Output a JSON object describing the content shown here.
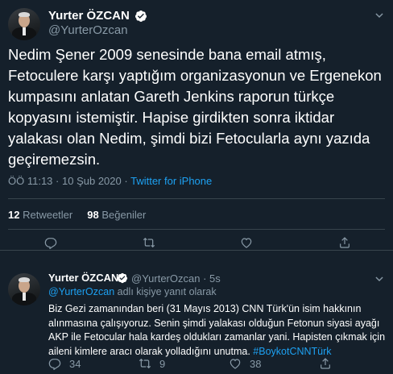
{
  "main_tweet": {
    "author_name": "Yurter ÖZCAN",
    "author_handle": "@YurterOzcan",
    "text_lines": [
      "Nedim Şener 2009 senesinde bana email atmış,",
      "Fetoculere karşı yaptığım organizasyonun ve Ergenekon",
      "kumpasını anlatan Gareth Jenkins raporun türkçe",
      "kopyasını istemiştir. Hapise girdikten sonra iktidar",
      "yalakası olan Nedim, şimdi bizi Fetocularla aynı yazıda",
      "geçiremezsin."
    ],
    "time": "ÖÖ 11:13",
    "separator": "·",
    "date": "10 Şub 2020",
    "source": "Twitter for iPhone",
    "retweet_count": "12",
    "retweet_label": "Retweetler",
    "like_count": "98",
    "like_label": "Beğeniler"
  },
  "reply": {
    "author_name": "Yurter ÖZCAN",
    "author_handle": "@YurterOzcan",
    "separator": "·",
    "age": "5s",
    "replying_mention": "@YurterOzcan",
    "replying_suffix": " adlı kişiye yanıt olarak",
    "text": "Biz Gezi zamanından beri (31 Mayıs 2013) CNN Türk'ün isim hakkının alınmasına çalışıyoruz. Senin şimdi yalakası olduğun Fetonun siyasi ayağı AKP ile Fetocular hala kardeş oldukları zamanlar yani. Hapisten çıkmak için aileni kimlere aracı olarak yolladığını unutma. ",
    "hashtag": "#BoykotCNNTürk",
    "reply_count": "34",
    "retweet_count": "9",
    "like_count": "38"
  },
  "icons": [
    "verified-badge-icon",
    "chevron-down-icon",
    "reply-icon",
    "retweet-icon",
    "like-icon",
    "share-icon"
  ],
  "colors": {
    "background": "#15202b",
    "text": "#ffffff",
    "secondary": "#8899a6",
    "accent": "#1da1f2",
    "divider": "#38444d"
  }
}
